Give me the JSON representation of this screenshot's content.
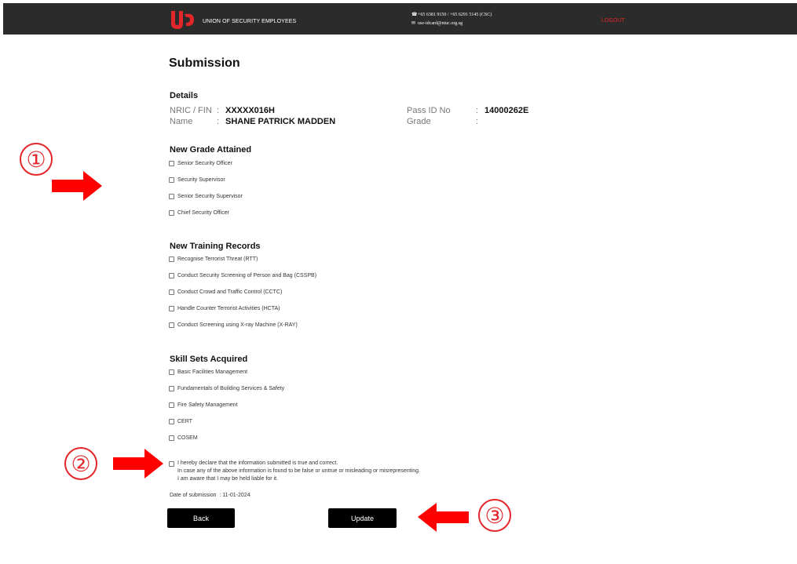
{
  "header": {
    "brand": "UNION OF SECURITY EMPLOYEES",
    "phone": "+65 6381 9150 / +65 6291 5145 (CSC)",
    "email": "use-idcard@ntuc.org.sg",
    "logout": "LOGOUT"
  },
  "page": {
    "title": "Submission"
  },
  "details": {
    "heading": "Details",
    "nric_label": "NRIC / FIN",
    "nric_value": "XXXXX016H",
    "name_label": "Name",
    "name_value": "SHANE PATRICK MADDEN",
    "pass_label": "Pass ID No",
    "pass_value": "14000262E",
    "grade_label": "Grade",
    "grade_value": "",
    "colon": ":"
  },
  "grade": {
    "heading": "New Grade Attained",
    "options": [
      "Senior Security Officer",
      "Security Supervisor",
      "Senior Security Supervisor",
      "Chief Security Officer"
    ]
  },
  "training": {
    "heading": "New Training Records",
    "options": [
      "Recognise Terrorist Threat (RTT)",
      "Conduct Security Screening of Person and Bag (CSSPB)",
      "Conduct Crowd and Traffic Control (CCTC)",
      "Handle Counter Terrorist Activities (HCTA)",
      "Conduct Screening using X-ray Machine (X-RAY)"
    ]
  },
  "skills": {
    "heading": "Skill Sets Acquired",
    "options": [
      "Basic Facilities Management",
      "Fundamentals of Building Services & Safety",
      "Fire Safety Management",
      "CERT",
      "COSEM"
    ]
  },
  "declaration": {
    "line1": "I hereby declare that the information submitted is true and correct.",
    "line2": "In case any of the above information is found to be false or untrue or misleading or misrepresenting.",
    "line3": "I am aware that I may be held liable for it."
  },
  "submission": {
    "date_label": "Date of submission",
    "date_value": ": 11-01-2024"
  },
  "buttons": {
    "back": "Back",
    "update": "Update"
  },
  "annotations": {
    "one": "①",
    "two": "②",
    "three": "③"
  },
  "colors": {
    "accent": "#e3262a",
    "topbar": "#2b2b2b"
  },
  "icons": [
    "phone-icon",
    "mail-icon",
    "logo-icon",
    "arrow-right-icon",
    "arrow-left-icon"
  ]
}
